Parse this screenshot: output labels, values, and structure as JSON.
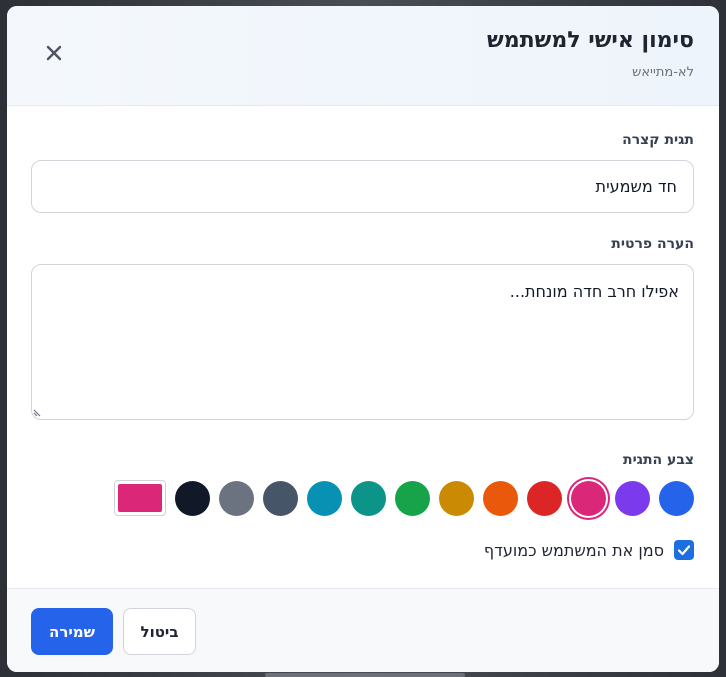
{
  "modal": {
    "title": "סימון אישי למשתמש",
    "subtitle": "לא-מתייאש",
    "close_icon": "close-icon"
  },
  "short_tag": {
    "label": "תגית קצרה",
    "value": "חד משמעית"
  },
  "private_note": {
    "label": "הערה פרטית",
    "value": "אפילו חרב חדה מונחת..."
  },
  "tag_color": {
    "label": "צבע התגית",
    "selected": "#db2777",
    "swatches": [
      "#2563eb",
      "#7c3aed",
      "#db2777",
      "#dc2626",
      "#ea580c",
      "#ca8a04",
      "#16a34a",
      "#0d9488",
      "#0891b2",
      "#475569",
      "#6b7280",
      "#111827"
    ],
    "custom_color": "#db2777"
  },
  "mark_important": {
    "label": "סמן את המשתמש כמועדף",
    "checked": true
  },
  "footer": {
    "save_label": "שמירה",
    "cancel_label": "ביטול"
  }
}
